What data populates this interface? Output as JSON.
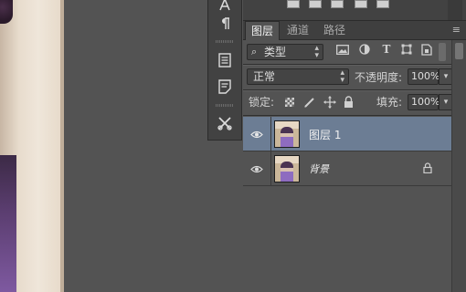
{
  "colors": {
    "panel_bg": "#535353",
    "panel_dark": "#424242",
    "selected_row": "#6c7d94",
    "text": "#d6d6d6"
  },
  "tool_strip": {
    "items": [
      {
        "icon": "character-icon",
        "glyph": "A"
      },
      {
        "icon": "paragraph-icon",
        "glyph": "¶"
      },
      {
        "icon": "properties-icon",
        "glyph": ""
      },
      {
        "icon": "notes-icon",
        "glyph": ""
      },
      {
        "icon": "tools-icon",
        "glyph": "✂"
      }
    ]
  },
  "layers_panel": {
    "tabs": [
      {
        "label": "图层",
        "active": true
      },
      {
        "label": "通道",
        "active": false
      },
      {
        "label": "路径",
        "active": false
      }
    ],
    "menu_icon": "≡",
    "filter": {
      "value": "类型",
      "search_glyph": "⌕",
      "icons": [
        "image-filter-icon",
        "adjustment-filter-icon",
        "type-filter-icon",
        "shape-filter-icon",
        "smart-object-filter-icon"
      ]
    },
    "blend_mode": "正常",
    "opacity_label": "不透明度:",
    "opacity_value": "100%",
    "lock_label": "锁定:",
    "fill_label": "填充:",
    "fill_value": "100%",
    "layers": [
      {
        "name": "图层 1",
        "selected": true,
        "visible": true,
        "locked": false
      },
      {
        "name": "背景",
        "selected": false,
        "visible": true,
        "locked": true
      }
    ]
  }
}
